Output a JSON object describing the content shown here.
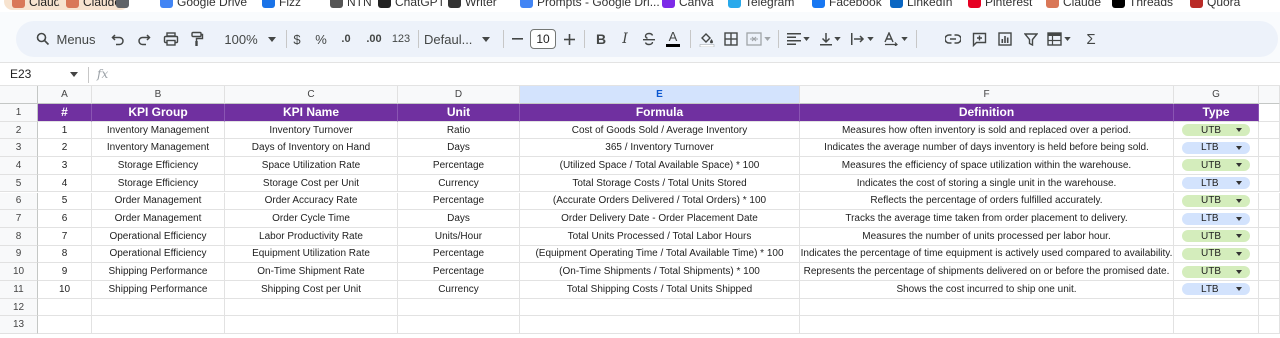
{
  "bookmarks": [
    {
      "label": "Claude",
      "pill": true,
      "icon": "claude-icon",
      "color": "#d97757"
    },
    {
      "label": "Claude",
      "pill": true,
      "icon": "claude-icon",
      "color": "#d97757"
    },
    {
      "label": "",
      "pill": false,
      "icon": "apps-grid-icon",
      "color": "#5f6368"
    },
    {
      "label": "Google Drive",
      "pill": false,
      "icon": "google-drive-icon",
      "color": "#4285f4"
    },
    {
      "label": "Fizz",
      "pill": false,
      "icon": "fizz-icon",
      "color": "#1a73e8"
    },
    {
      "label": "NTN",
      "pill": false,
      "icon": "ntn-icon",
      "color": "#555555"
    },
    {
      "label": "ChatGPT",
      "pill": false,
      "icon": "chatgpt-icon",
      "color": "#222222"
    },
    {
      "label": "Writer",
      "pill": false,
      "icon": "writer-icon",
      "color": "#333333"
    },
    {
      "label": "Prompts - Google Dri...",
      "pill": false,
      "icon": "google-docs-icon",
      "color": "#4285f4"
    },
    {
      "label": "Canva",
      "pill": false,
      "icon": "canva-icon",
      "color": "#7d2ae8"
    },
    {
      "label": "Telegram",
      "pill": false,
      "icon": "telegram-icon",
      "color": "#29a9eb"
    },
    {
      "label": "Facebook",
      "pill": false,
      "icon": "facebook-icon",
      "color": "#1877f2"
    },
    {
      "label": "LinkedIn",
      "pill": false,
      "icon": "linkedin-icon",
      "color": "#0a66c2"
    },
    {
      "label": "Pinterest",
      "pill": false,
      "icon": "pinterest-icon",
      "color": "#e60023"
    },
    {
      "label": "Claude",
      "pill": false,
      "icon": "claude-icon",
      "color": "#d97757"
    },
    {
      "label": "Threads",
      "pill": false,
      "icon": "threads-icon",
      "color": "#000000"
    },
    {
      "label": "Quora",
      "pill": false,
      "icon": "quora-icon",
      "color": "#b92b27"
    }
  ],
  "toolbar": {
    "menus_label": "Menus",
    "zoom": "100%",
    "currency": "$",
    "percent": "%",
    "dec_decrease": ".0",
    "dec_increase": ".00",
    "number_format": "123",
    "font_name": "Defaul...",
    "font_size": "10",
    "bold": "B",
    "italic": "I",
    "text_color_letter": "A",
    "sum": "Σ"
  },
  "formula_bar": {
    "cell_ref": "E23",
    "fx": "fx",
    "value": ""
  },
  "sheet": {
    "columns": [
      "A",
      "B",
      "C",
      "D",
      "E",
      "F",
      "G"
    ],
    "selected_column": "E",
    "row_numbers": [
      "1",
      "2",
      "3",
      "4",
      "5",
      "6",
      "7",
      "8",
      "9",
      "10",
      "11",
      "12",
      "13"
    ],
    "header_bg": "#7030a0",
    "headers": [
      "#",
      "KPI Group",
      "KPI Name",
      "Unit",
      "Formula",
      "Definition",
      "Type"
    ],
    "rows": [
      [
        "1",
        "Inventory Management",
        "Inventory Turnover",
        "Ratio",
        "Cost of Goods Sold / Average Inventory",
        "Measures how often inventory is sold and replaced over a period.",
        "UTB"
      ],
      [
        "2",
        "Inventory Management",
        "Days of Inventory on Hand",
        "Days",
        "365 / Inventory Turnover",
        "Indicates the average number of days inventory is held before being sold.",
        "LTB"
      ],
      [
        "3",
        "Storage Efficiency",
        "Space Utilization Rate",
        "Percentage",
        "(Utilized Space / Total Available Space) * 100",
        "Measures the efficiency of space utilization within the warehouse.",
        "UTB"
      ],
      [
        "4",
        "Storage Efficiency",
        "Storage Cost per Unit",
        "Currency",
        "Total Storage Costs / Total Units Stored",
        "Indicates the cost of storing a single unit in the warehouse.",
        "LTB"
      ],
      [
        "5",
        "Order Management",
        "Order Accuracy Rate",
        "Percentage",
        "(Accurate Orders Delivered / Total Orders) * 100",
        "Reflects the percentage of orders fulfilled accurately.",
        "UTB"
      ],
      [
        "6",
        "Order Management",
        "Order Cycle Time",
        "Days",
        "Order Delivery Date - Order Placement Date",
        "Tracks the average time taken from order placement to delivery.",
        "LTB"
      ],
      [
        "7",
        "Operational Efficiency",
        "Labor Productivity Rate",
        "Units/Hour",
        "Total Units Processed / Total Labor Hours",
        "Measures the number of units processed per labor hour.",
        "UTB"
      ],
      [
        "8",
        "Operational Efficiency",
        "Equipment Utilization Rate",
        "Percentage",
        "(Equipment Operating Time / Total Available Time) * 100",
        "Indicates the percentage of time equipment is actively used compared to availability.",
        "UTB"
      ],
      [
        "9",
        "Shipping Performance",
        "On-Time Shipment Rate",
        "Percentage",
        "(On-Time Shipments / Total Shipments) * 100",
        "Represents the percentage of shipments delivered on or before the promised date.",
        "UTB"
      ],
      [
        "10",
        "Shipping Performance",
        "Shipping Cost per Unit",
        "Currency",
        "Total Shipping Costs / Total Units Shipped",
        "Shows the cost incurred to ship one unit.",
        "LTB"
      ]
    ],
    "type_colors": {
      "UTB": "#d4edbc",
      "LTB": "#d3e3fd"
    }
  }
}
